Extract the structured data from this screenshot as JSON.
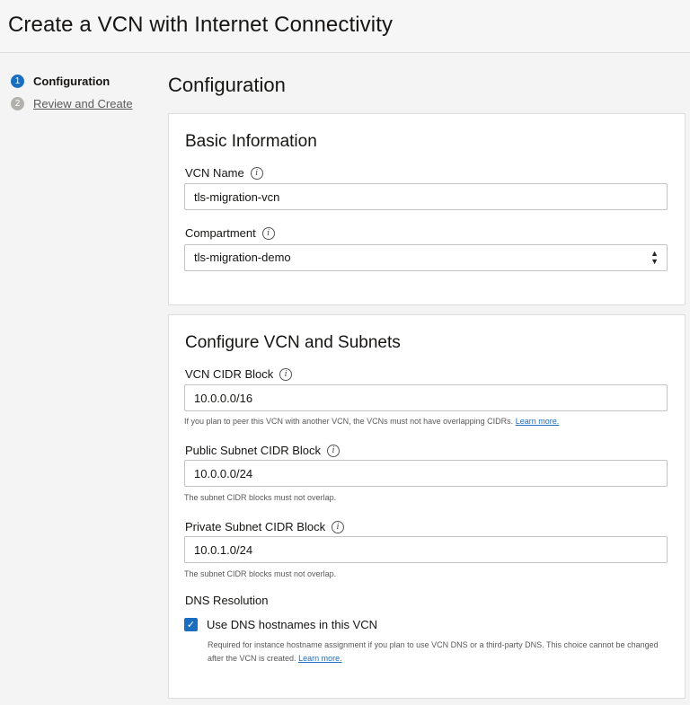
{
  "header": {
    "title": "Create a VCN with Internet Connectivity"
  },
  "steps": [
    {
      "number": "1",
      "label": "Configuration",
      "active": true
    },
    {
      "number": "2",
      "label": "Review and Create",
      "active": false
    }
  ],
  "main": {
    "title": "Configuration",
    "basic_info": {
      "title": "Basic Information",
      "vcn_name": {
        "label": "VCN Name",
        "value": "tls-migration-vcn"
      },
      "compartment": {
        "label": "Compartment",
        "value": "tls-migration-demo"
      }
    },
    "vcn_subnets": {
      "title": "Configure VCN and Subnets",
      "vcn_cidr": {
        "label": "VCN CIDR Block",
        "value": "10.0.0.0/16",
        "help": "If you plan to peer this VCN with another VCN, the VCNs must not have overlapping CIDRs.",
        "help_link": "Learn more."
      },
      "public_subnet": {
        "label": "Public Subnet CIDR Block",
        "value": "10.0.0.0/24",
        "help": "The subnet CIDR blocks must not overlap."
      },
      "private_subnet": {
        "label": "Private Subnet CIDR Block",
        "value": "10.0.1.0/24",
        "help": "The subnet CIDR blocks must not overlap."
      },
      "dns": {
        "label": "DNS Resolution",
        "checkbox_label": "Use DNS hostnames in this VCN",
        "checked": true,
        "help": "Required for instance hostname assignment if you plan to use VCN DNS or a third-party DNS. This choice cannot be changed after the VCN is created.",
        "help_link": "Learn more."
      }
    }
  },
  "icons": {
    "info": "i",
    "check": "✓",
    "select_up": "▲",
    "select_down": "▼"
  },
  "colors": {
    "accent": "#1a6dbf",
    "inactive_step": "#b2b0ad"
  }
}
